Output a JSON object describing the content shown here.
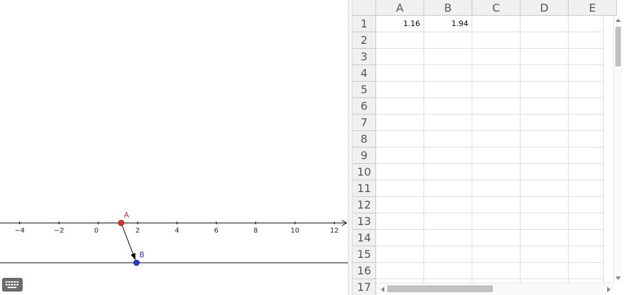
{
  "graphics": {
    "x_ticks": [
      "−4",
      "−2",
      "0",
      "2",
      "4",
      "6",
      "8",
      "10",
      "12"
    ],
    "point_a": {
      "label": "A",
      "value": 1.16,
      "color": "#e0302c"
    },
    "point_b": {
      "label": "B",
      "value": 1.94,
      "color": "#2a3bd6"
    },
    "axis_color": "#000000",
    "arrow_color": "#000000"
  },
  "spreadsheet": {
    "columns": [
      "A",
      "B",
      "C",
      "D",
      "E"
    ],
    "rows": [
      "1",
      "2",
      "3",
      "4",
      "5",
      "6",
      "7",
      "8",
      "9",
      "10",
      "11",
      "12",
      "13",
      "14",
      "15",
      "16",
      "17"
    ],
    "cells": {
      "A1": "1.16",
      "B1": "1.94"
    }
  },
  "keyboard": {
    "icon": "keyboard-icon"
  }
}
